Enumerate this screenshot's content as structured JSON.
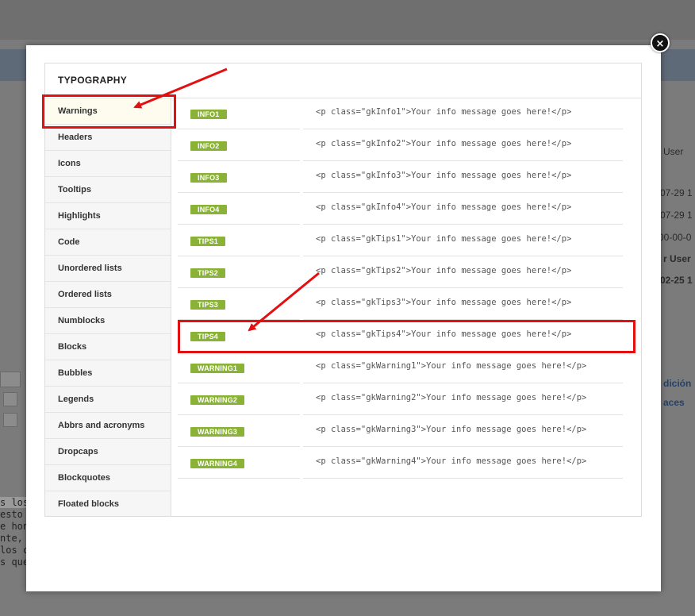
{
  "background": {
    "right_texts": [
      "User",
      "07-29 1",
      "07-29 1",
      "00-00-0",
      "r User",
      "02-25 1",
      "dición",
      "aces"
    ],
    "left_texts": [
      "s los s",
      "esto de",
      "e honra",
      "nte, y",
      "los cin",
      "s que"
    ]
  },
  "modal": {
    "close_label": "×",
    "title": "TYPOGRAPHY",
    "sidebar": [
      "Warnings",
      "Headers",
      "Icons",
      "Tooltips",
      "Highlights",
      "Code",
      "Unordered lists",
      "Ordered lists",
      "Numblocks",
      "Blocks",
      "Bubbles",
      "Legends",
      "Abbrs and acronyms",
      "Dropcaps",
      "Blockquotes",
      "Floated blocks"
    ],
    "active_item": "Warnings",
    "rows": [
      {
        "badge": "INFO1",
        "code": "<p class=\"gkInfo1\">Your info message goes here!</p>"
      },
      {
        "badge": "INFO2",
        "code": "<p class=\"gkInfo2\">Your info message goes here!</p>"
      },
      {
        "badge": "INFO3",
        "code": "<p class=\"gkInfo3\">Your info message goes here!</p>"
      },
      {
        "badge": "INFO4",
        "code": "<p class=\"gkInfo4\">Your info message goes here!</p>"
      },
      {
        "badge": "TIPS1",
        "code": "<p class=\"gkTips1\">Your info message goes here!</p>"
      },
      {
        "badge": "TIPS2",
        "code": "<p class=\"gkTips2\">Your info message goes here!</p>"
      },
      {
        "badge": "TIPS3",
        "code": "<p class=\"gkTips3\">Your info message goes here!</p>"
      },
      {
        "badge": "TIPS4",
        "code": "<p class=\"gkTips4\">Your info message goes here!</p>"
      },
      {
        "badge": "WARNING1",
        "code": "<p class=\"gkWarning1\">Your info message goes here!</p>"
      },
      {
        "badge": "WARNING2",
        "code": "<p class=\"gkWarning2\">Your info message goes here!</p>"
      },
      {
        "badge": "WARNING3",
        "code": "<p class=\"gkWarning3\">Your info message goes here!</p>"
      },
      {
        "badge": "WARNING4",
        "code": "<p class=\"gkWarning4\">Your info message goes here!</p>"
      }
    ],
    "badge_color": "#8ab236",
    "highlight_color": "#e21010"
  }
}
